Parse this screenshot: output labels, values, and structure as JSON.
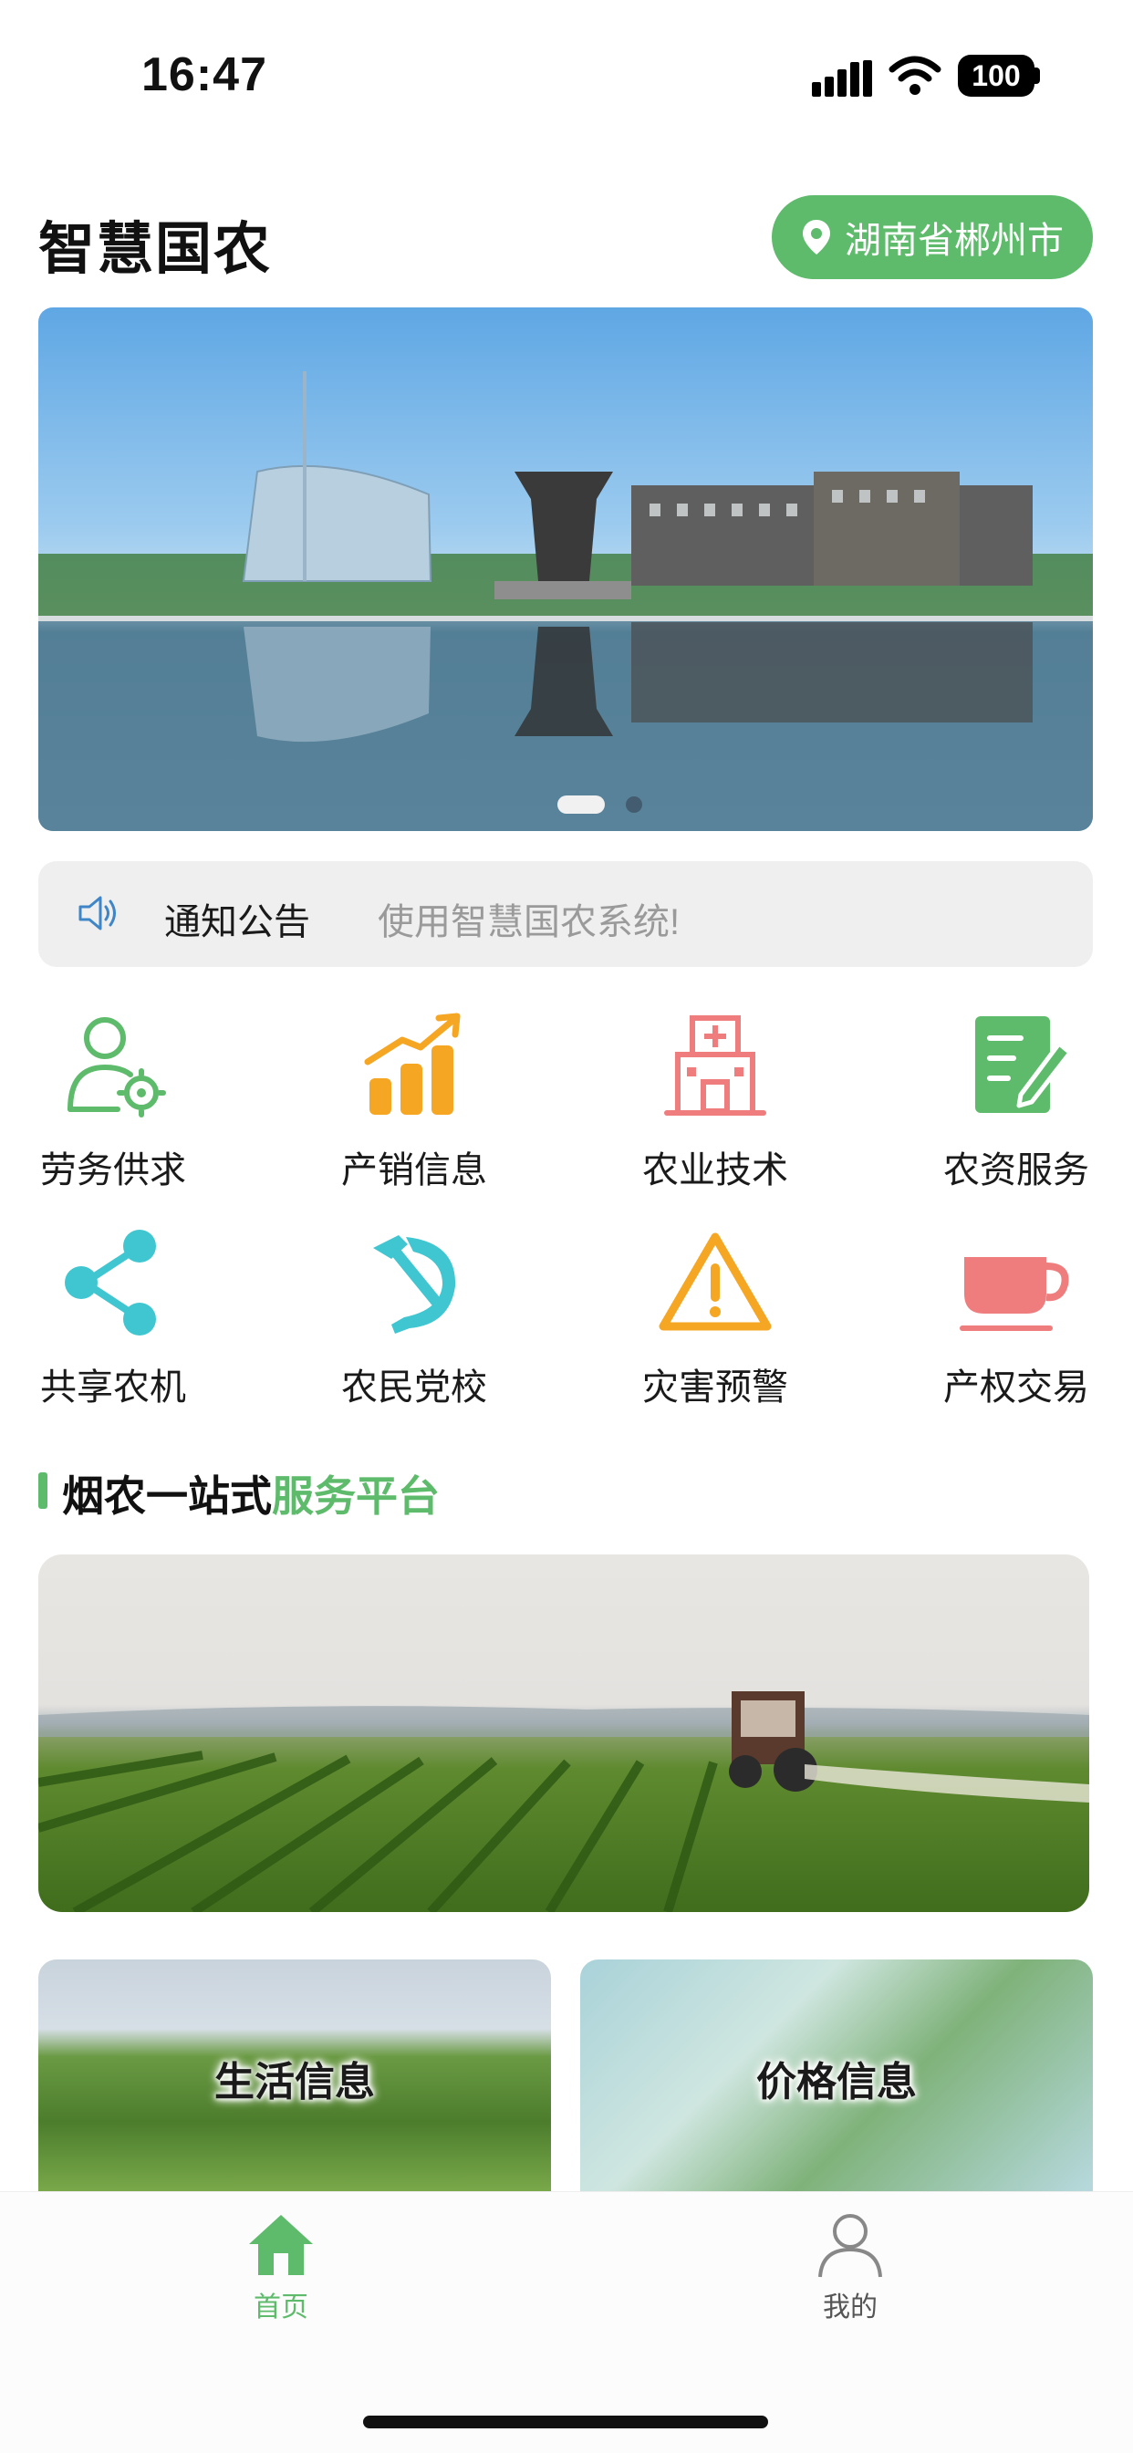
{
  "status_bar": {
    "time": "16:47",
    "battery": "100"
  },
  "header": {
    "title": "智慧国农",
    "location": "湖南省郴州市"
  },
  "banner": {
    "page_count": 2,
    "active_page": 1
  },
  "notice": {
    "label": "通知公告",
    "text": "使用智慧国农系统!"
  },
  "services": [
    {
      "label": "劳务供求",
      "icon": "worker-gear-icon"
    },
    {
      "label": "产销信息",
      "icon": "bar-chart-icon"
    },
    {
      "label": "农业技术",
      "icon": "hospital-icon"
    },
    {
      "label": "农资服务",
      "icon": "document-edit-icon"
    },
    {
      "label": "共享农机",
      "icon": "share-icon"
    },
    {
      "label": "农民党校",
      "icon": "hammer-sickle-icon"
    },
    {
      "label": "灾害预警",
      "icon": "warning-icon"
    },
    {
      "label": "产权交易",
      "icon": "cup-icon"
    }
  ],
  "section": {
    "title_main": "烟农一站式",
    "title_accent": "服务平台"
  },
  "cards": [
    {
      "label": "生活信息"
    },
    {
      "label": "价格信息"
    }
  ],
  "tabbar": {
    "home": "首页",
    "mine": "我的"
  },
  "colors": {
    "accent": "#5ebb6b",
    "orange": "#f5a623",
    "pink": "#ef7d7d",
    "teal": "#3fc6d0",
    "blue": "#3e86c8"
  }
}
